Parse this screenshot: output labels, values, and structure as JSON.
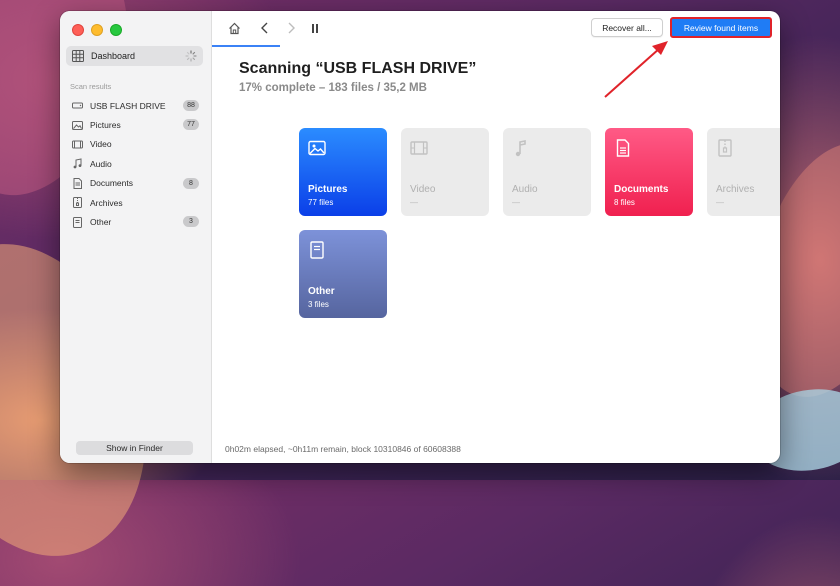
{
  "sidebar": {
    "dashboard_label": "Dashboard",
    "section_label": "Scan results",
    "items": [
      {
        "label": "USB FLASH DRIVE",
        "badge": "88",
        "icon": "drive-icon"
      },
      {
        "label": "Pictures",
        "badge": "77",
        "icon": "picture-icon"
      },
      {
        "label": "Video",
        "badge": "",
        "icon": "video-icon"
      },
      {
        "label": "Audio",
        "badge": "",
        "icon": "music-note-icon"
      },
      {
        "label": "Documents",
        "badge": "8",
        "icon": "document-icon"
      },
      {
        "label": "Archives",
        "badge": "",
        "icon": "archive-icon"
      },
      {
        "label": "Other",
        "badge": "3",
        "icon": "other-file-icon"
      }
    ],
    "show_in_finder_label": "Show in Finder"
  },
  "toolbar": {
    "recover_label": "Recover all...",
    "review_label": "Review found items",
    "icons": [
      "home-icon",
      "chevron-left-icon",
      "chevron-right-icon",
      "pause-icon"
    ]
  },
  "scan": {
    "title": "Scanning “USB FLASH DRIVE”",
    "progress": "17% complete – 183 files / 35,2 MB",
    "progress_percent": 17
  },
  "cards": [
    {
      "name": "Pictures",
      "count": "77 files",
      "active": true,
      "color_top": "#2b8cff",
      "color_bottom": "#0b3fe8",
      "icon": "picture-icon"
    },
    {
      "name": "Video",
      "count": "—",
      "active": false,
      "icon": "video-icon"
    },
    {
      "name": "Audio",
      "count": "—",
      "active": false,
      "icon": "music-note-icon"
    },
    {
      "name": "Documents",
      "count": "8 files",
      "active": true,
      "color_top": "#ff5a86",
      "color_bottom": "#f0204f",
      "icon": "document-icon"
    },
    {
      "name": "Archives",
      "count": "—",
      "active": false,
      "icon": "archive-icon"
    },
    {
      "name": "Other",
      "count": "3 files",
      "active": true,
      "color_top": "#7d92d9",
      "color_bottom": "#56659f",
      "icon": "other-file-icon"
    }
  ],
  "status": "0h02m elapsed, ~0h11m remain, block 10310846 of 60608388",
  "colors": {
    "accent": "#1f7cf5",
    "annotation_red": "#e0232a"
  }
}
